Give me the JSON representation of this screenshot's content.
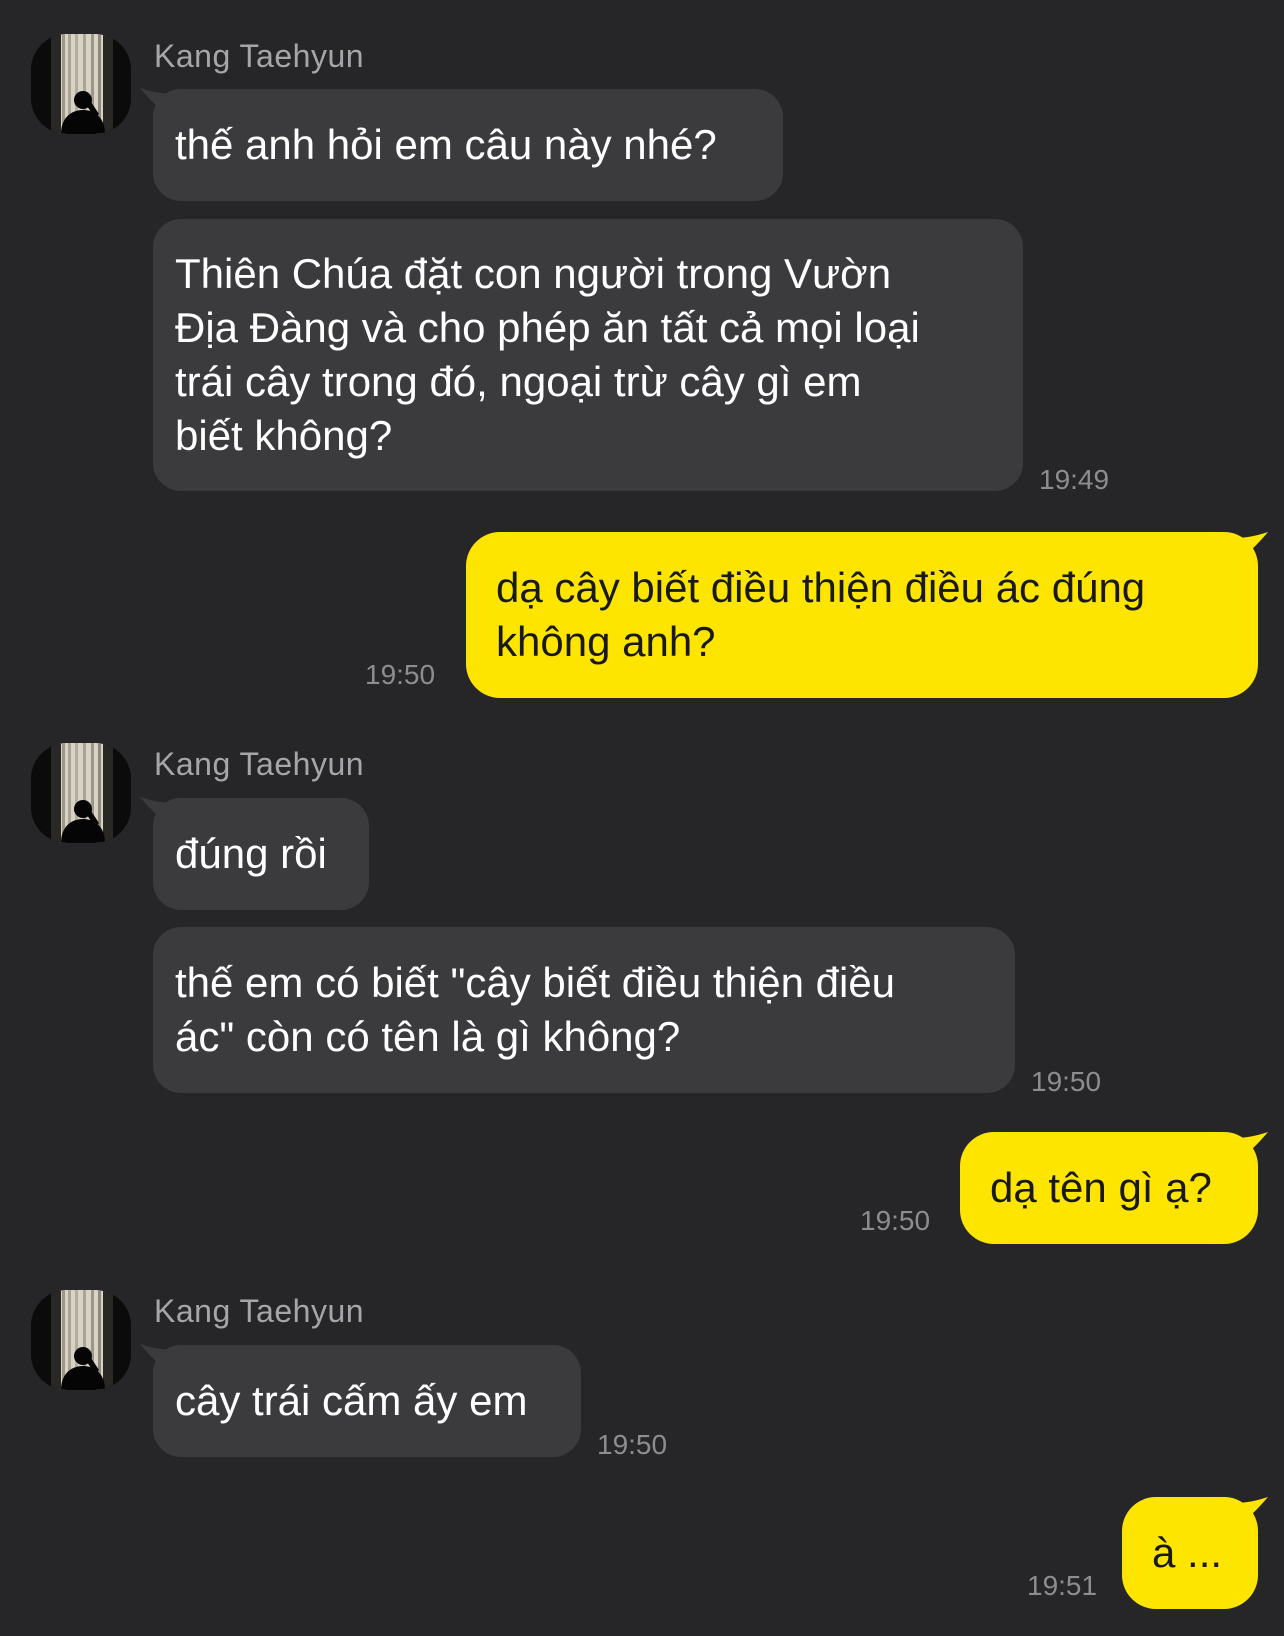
{
  "chat": {
    "sender_name": "Kang Taehyun",
    "avatar_icon": "silhouette-window-avatar",
    "colors": {
      "background": "#262628",
      "incoming_bubble": "#3b3b3e",
      "outgoing_bubble": "#fee500",
      "timestamp": "#8d8d91",
      "sender_name": "#a6a6aa"
    },
    "messages": [
      {
        "dir": "in",
        "text": "thế anh hỏi em câu này nhé?"
      },
      {
        "dir": "in",
        "text": "Thiên Chúa đặt con người trong Vườn\nĐịa Đàng và cho phép ăn tất cả mọi loại\ntrái cây trong đó, ngoại trừ cây gì em\nbiết không?",
        "time": "19:49"
      },
      {
        "dir": "out",
        "text": "dạ cây biết điều thiện điều ác đúng\nkhông anh?",
        "time": "19:50"
      },
      {
        "dir": "in",
        "text": "đúng rồi"
      },
      {
        "dir": "in",
        "text": "thế em có biết \"cây biết điều thiện điều\nác\" còn có tên là gì không?",
        "time": "19:50"
      },
      {
        "dir": "out",
        "text": "dạ tên gì ạ?",
        "time": "19:50"
      },
      {
        "dir": "in",
        "text": "cây trái cấm ấy em",
        "time": "19:50"
      },
      {
        "dir": "out",
        "text": "à ...",
        "time": "19:51"
      }
    ]
  }
}
